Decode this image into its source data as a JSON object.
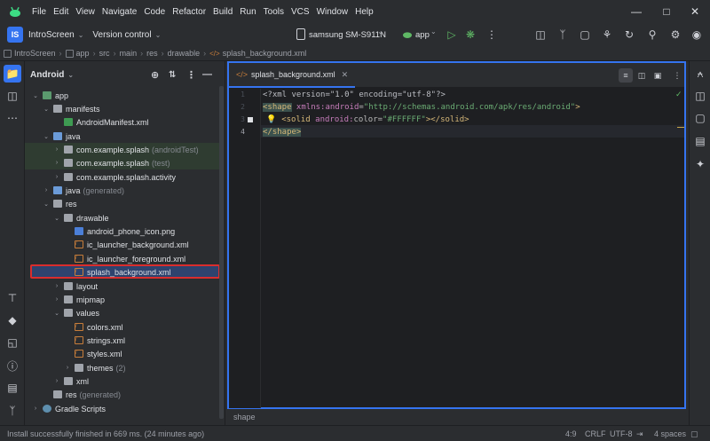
{
  "menu": [
    "File",
    "Edit",
    "View",
    "Navigate",
    "Code",
    "Refactor",
    "Build",
    "Run",
    "Tools",
    "VCS",
    "Window",
    "Help"
  ],
  "toolbar": {
    "project_badge": "IS",
    "project_name": "IntroScreen",
    "version_control": "Version control",
    "device": "samsung SM-S911N",
    "run_config": "app"
  },
  "breadcrumb": [
    "IntroScreen",
    "app",
    "src",
    "main",
    "res",
    "drawable",
    "splash_background.xml"
  ],
  "project_panel": {
    "title": "Android",
    "tree": [
      {
        "label": "app",
        "muted": "",
        "level": 0
      },
      {
        "label": "manifests",
        "muted": "",
        "level": 1
      },
      {
        "label": "AndroidManifest.xml",
        "muted": "",
        "level": 2
      },
      {
        "label": "java",
        "muted": "",
        "level": 1
      },
      {
        "label": "com.example.splash",
        "muted": "(androidTest)",
        "level": 2
      },
      {
        "label": "com.example.splash",
        "muted": "(test)",
        "level": 2
      },
      {
        "label": "com.example.splash.activity",
        "muted": "",
        "level": 2
      },
      {
        "label": "java",
        "muted": "(generated)",
        "level": 1
      },
      {
        "label": "res",
        "muted": "",
        "level": 1
      },
      {
        "label": "drawable",
        "muted": "",
        "level": 2
      },
      {
        "label": "android_phone_icon.png",
        "muted": "",
        "level": 3
      },
      {
        "label": "ic_launcher_background.xml",
        "muted": "",
        "level": 3
      },
      {
        "label": "ic_launcher_foreground.xml",
        "muted": "",
        "level": 3
      },
      {
        "label": "splash_background.xml",
        "muted": "",
        "level": 3
      },
      {
        "label": "layout",
        "muted": "",
        "level": 2
      },
      {
        "label": "mipmap",
        "muted": "",
        "level": 2
      },
      {
        "label": "values",
        "muted": "",
        "level": 2
      },
      {
        "label": "colors.xml",
        "muted": "",
        "level": 3
      },
      {
        "label": "strings.xml",
        "muted": "",
        "level": 3
      },
      {
        "label": "styles.xml",
        "muted": "",
        "level": 3
      },
      {
        "label": "themes",
        "muted": "(2)",
        "level": 3
      },
      {
        "label": "xml",
        "muted": "",
        "level": 2
      },
      {
        "label": "res",
        "muted": "(generated)",
        "level": 1
      },
      {
        "label": "Gradle Scripts",
        "muted": "",
        "level": 0
      }
    ]
  },
  "editor": {
    "tab_label": "splash_background.xml",
    "line_numbers": [
      "1",
      "2",
      "3",
      "4"
    ],
    "lines": {
      "l1": "<?xml version=\"1.0\" encoding=\"utf-8\"?>",
      "l2_open": "<shape",
      "l2_ns": " xmlns:android",
      "l2_eq": "=",
      "l2_val": "\"http://schemas.android.com/apk/res/android\"",
      "l2_close": ">",
      "l3_open": "<solid",
      "l3_ns": " android:",
      "l3_attr": "color",
      "l3_eq": "=",
      "l3_val": "\"#FFFFFF\"",
      "l3_close": "></solid>",
      "l4": "</shape>"
    },
    "status_path": "shape"
  },
  "statusbar": {
    "message": "Install successfully finished in 669 ms. (24 minutes ago)",
    "position": "4:9",
    "line_sep": "CRLF",
    "encoding": "UTF-8",
    "indent": "4 spaces"
  },
  "colors": {
    "accent": "#3574f0",
    "selection_outline": "#d92d2d"
  }
}
